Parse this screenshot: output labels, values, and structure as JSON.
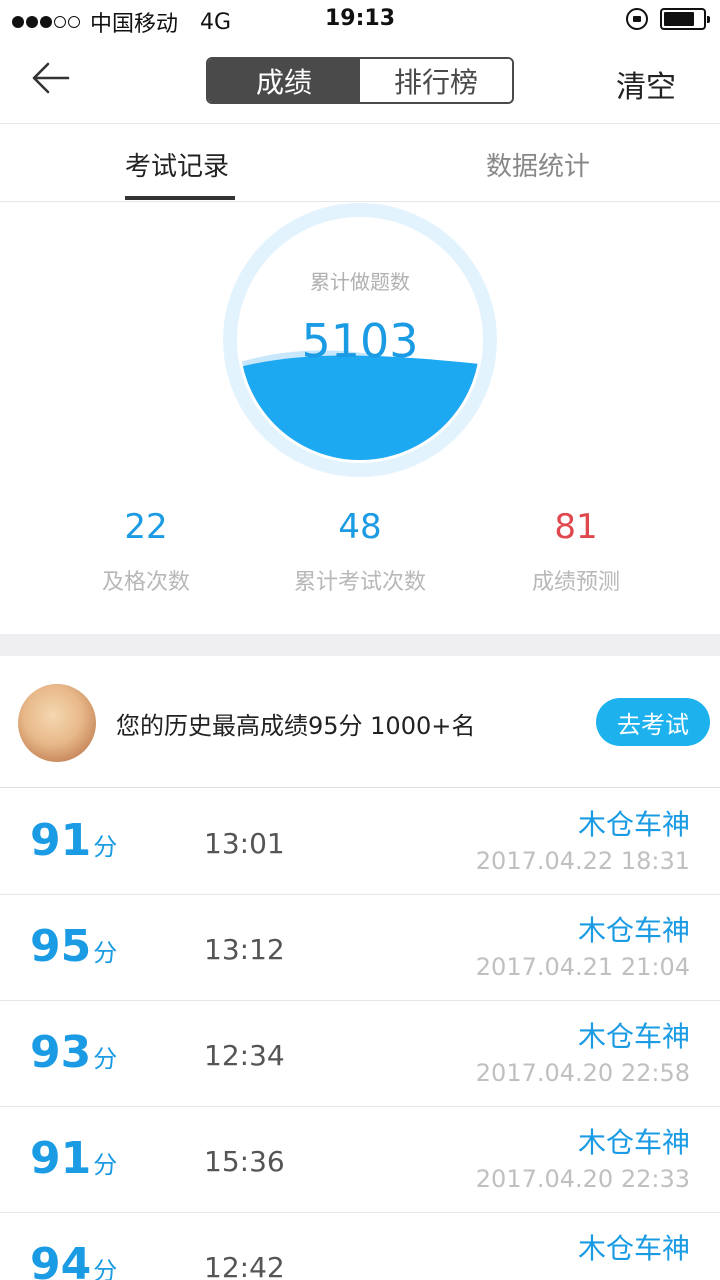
{
  "status": {
    "carrier": "中国移动",
    "network": "4G",
    "time": "19:13"
  },
  "nav": {
    "segments": [
      "成绩",
      "排行榜"
    ],
    "clear_label": "清空"
  },
  "tabs": [
    "考试记录",
    "数据统计"
  ],
  "gauge": {
    "label": "累计做题数",
    "value": "5103",
    "fill_fraction": 0.4
  },
  "stats": [
    {
      "value": "22",
      "label": "及格次数"
    },
    {
      "value": "48",
      "label": "累计考试次数"
    },
    {
      "value": "81",
      "label": "成绩预测"
    }
  ],
  "summary": {
    "text": "您的历史最高成绩95分 1000+名",
    "button": "去考试"
  },
  "records": [
    {
      "score": "91",
      "unit": "分",
      "duration": "13:01",
      "user": "木仓车神",
      "datetime": "2017.04.22 18:31"
    },
    {
      "score": "95",
      "unit": "分",
      "duration": "13:12",
      "user": "木仓车神",
      "datetime": "2017.04.21 21:04"
    },
    {
      "score": "93",
      "unit": "分",
      "duration": "12:34",
      "user": "木仓车神",
      "datetime": "2017.04.20 22:58"
    },
    {
      "score": "91",
      "unit": "分",
      "duration": "15:36",
      "user": "木仓车神",
      "datetime": "2017.04.20 22:33"
    },
    {
      "score": "94",
      "unit": "分",
      "duration": "12:42",
      "user": "木仓车神",
      "datetime": ""
    }
  ],
  "colors": {
    "accent": "#1a9be4",
    "button": "#1db2ee",
    "warning": "#e0484e",
    "dark": "#4a4a4a"
  }
}
